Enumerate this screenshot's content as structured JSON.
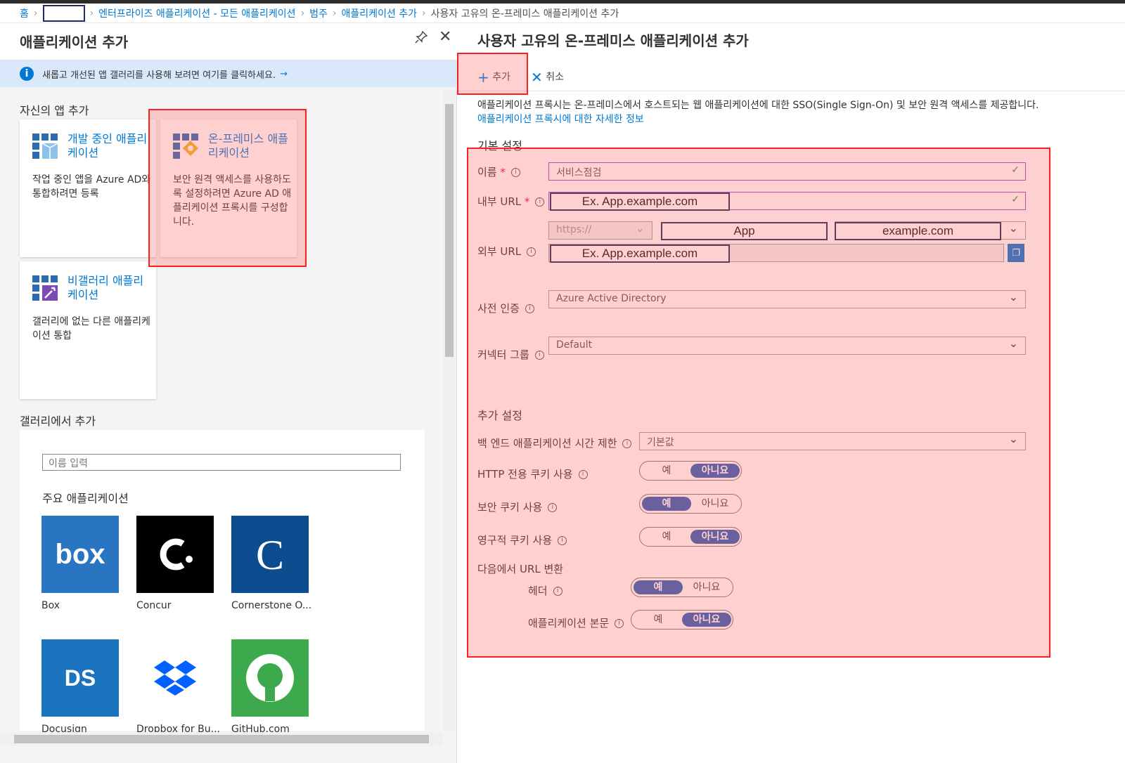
{
  "breadcrumb": {
    "home": "홈",
    "enterprise": "엔터프라이즈 애플리케이션 - 모든 애플리케이션",
    "category": "범주",
    "add_app": "애플리케이션 추가",
    "current": "사용자 고유의 온-프레미스 애플리케이션 추가"
  },
  "left": {
    "title": "애플리케이션 추가",
    "info_text": "새롭고 개선된 앱 갤러리를 사용해 보려면 여기를 클릭하세요.",
    "own_apps_heading": "자신의 앱 추가",
    "cards": [
      {
        "title": "개발 중인 애플리케이션",
        "desc": "작업 중인 앱을 Azure AD와 통합하려면 등록"
      },
      {
        "title": "온-프레미스 애플리케이션",
        "desc": "보안 원격 액세스를 사용하도록 설정하려면 Azure AD 애플리케이션 프록시를 구성합니다."
      },
      {
        "title": "비갤러리 애플리케이션",
        "desc": "갤러리에 없는 다른 애플리케이션 통합"
      }
    ],
    "gallery_heading": "갤러리에서 추가",
    "search_placeholder": "이름 입력",
    "featured_heading": "주요 애플리케이션",
    "featured_apps": [
      {
        "name": "Box",
        "logo_text": "box",
        "color": "#2a75c2"
      },
      {
        "name": "Concur",
        "logo_text": "C.",
        "color": "#000000"
      },
      {
        "name": "Cornerstone O...",
        "logo_text": "C",
        "color": "#0d4c8f"
      },
      {
        "name": "Docusign",
        "logo_text": "DS",
        "color": "#1b74bf"
      },
      {
        "name": "Dropbox for Bu...",
        "logo_text": "",
        "color": "#0061fe"
      },
      {
        "name": "GitHub.com",
        "logo_text": "",
        "color": "#3ba94c"
      }
    ]
  },
  "right": {
    "title": "사용자 고유의 온-프레미스 애플리케이션 추가",
    "toolbar": {
      "add": "추가",
      "cancel": "취소"
    },
    "description": "애플리케이션 프록시는 온-프레미스에서 호스트되는 웹 애플리케이션에 대한 SSO(Single Sign-On) 및 보안 원격 액세스를 제공합니다.",
    "description_link": "애플리케이션 프록시에 대한 자세한 정보",
    "basic_heading": "기본 설정",
    "name_label": "이름",
    "name_value": "서비스점검",
    "internal_url_label": "내부 URL",
    "internal_url_value": "Ex. App.example.com",
    "external_url_label": "외부 URL",
    "external_protocol": "https://",
    "external_sub": "App",
    "external_domain": "example.com",
    "external_full": "Ex. App.example.com",
    "preauth_label": "사전 인증",
    "preauth_value": "Azure Active Directory",
    "connector_label": "커넥터 그룹",
    "connector_value": "Default",
    "additional_heading": "추가 설정",
    "timeout_label": "백 엔드 애플리케이션 시간 제한",
    "timeout_value": "기본값",
    "toggle_yes": "예",
    "toggle_no": "아니요",
    "http_cookie_label": "HTTP 전용 쿠키 사용",
    "secure_cookie_label": "보안 쿠키 사용",
    "persistent_cookie_label": "영구적 쿠키 사용",
    "translate_heading": "다음에서 URL 변환",
    "header_label": "헤더",
    "body_label": "애플리케이션 본문"
  }
}
